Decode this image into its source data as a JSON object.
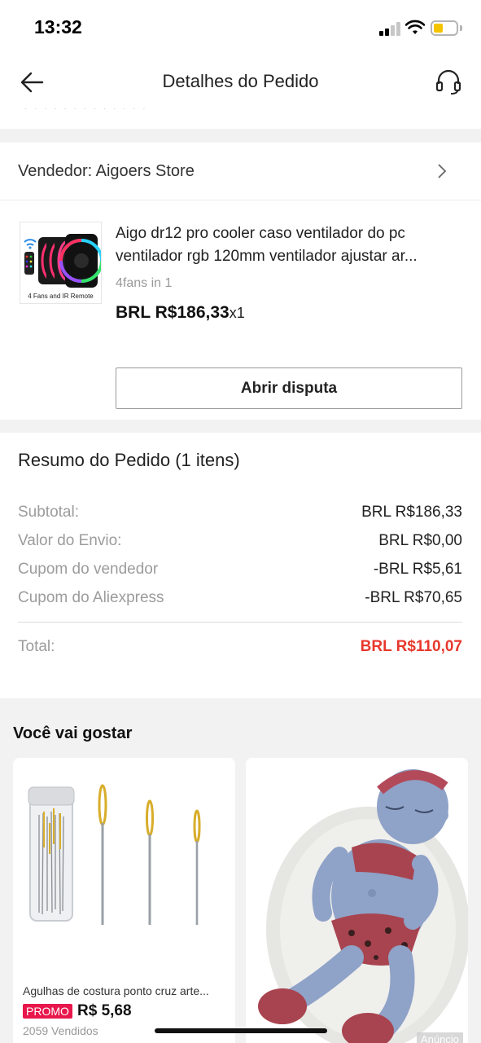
{
  "status_bar": {
    "time": "13:32"
  },
  "nav": {
    "title": "Detalhes do Pedido"
  },
  "seller": {
    "label": "Vendedor: Aigoers Store",
    "product": {
      "title_line1": "Aigo dr12 pro cooler caso ventilador do pc",
      "title_line2": "ventilador rgb 120mm ventilador ajustar ar...",
      "thumb_caption": "4 Fans and IR Remote",
      "variant": "4fans in 1",
      "price": "BRL R$186,33",
      "qty": "x1"
    },
    "dispute_button": "Abrir disputa"
  },
  "summary": {
    "title": "Resumo do Pedido (1 itens)",
    "rows": [
      {
        "label": "Subtotal:",
        "value": "BRL R$186,33"
      },
      {
        "label": "Valor do Envio:",
        "value": "BRL R$0,00"
      },
      {
        "label": "Cupom do vendedor",
        "value": "-BRL R$5,61"
      },
      {
        "label": "Cupom do Aliexpress",
        "value": "-BRL R$70,65"
      }
    ],
    "total": {
      "label": "Total:",
      "value": "BRL R$110,07"
    }
  },
  "recommendations": {
    "title": "Você vai gostar",
    "items": [
      {
        "name": "Agulhas de costura ponto cruz arte...",
        "promo": "PROMO",
        "price": "R$ 5,68",
        "sold": "2059 Vendidos"
      },
      {
        "ad_label": "Anúncio"
      }
    ]
  },
  "colors": {
    "accent_red": "#e8382c",
    "promo_pink": "#e8174c"
  }
}
